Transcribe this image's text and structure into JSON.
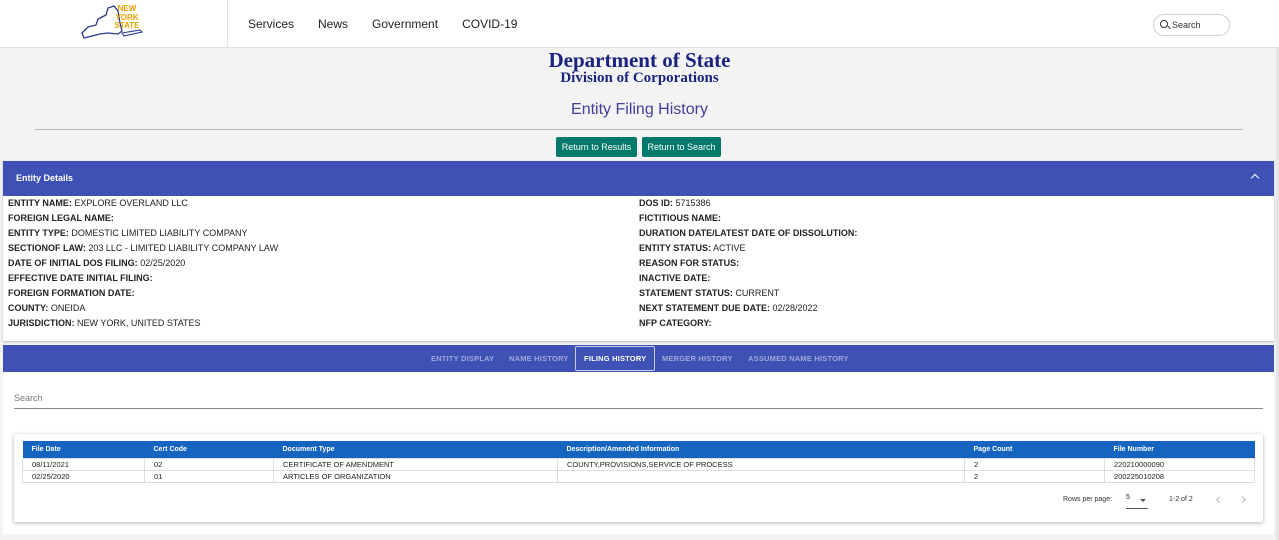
{
  "header": {
    "logo_lines": [
      "NEW",
      "YORK",
      "STATE"
    ],
    "nav": [
      "Services",
      "News",
      "Government",
      "COVID-19"
    ],
    "search_label": "Search"
  },
  "titles": {
    "department": "Department of State",
    "division": "Division of Corporations",
    "page": "Entity Filing History"
  },
  "buttons": {
    "return_results": "Return to Results",
    "return_search": "Return to Search"
  },
  "entity_details": {
    "heading": "Entity Details",
    "left": [
      {
        "label": "ENTITY NAME:",
        "value": "EXPLORE OVERLAND LLC"
      },
      {
        "label": "FOREIGN LEGAL NAME:",
        "value": ""
      },
      {
        "label": "ENTITY TYPE:",
        "value": "DOMESTIC LIMITED LIABILITY COMPANY"
      },
      {
        "label": "SECTIONOF LAW:",
        "value": "203 LLC - LIMITED LIABILITY COMPANY LAW"
      },
      {
        "label": "DATE OF INITIAL DOS FILING:",
        "value": "02/25/2020"
      },
      {
        "label": "EFFECTIVE DATE INITIAL FILING:",
        "value": ""
      },
      {
        "label": "FOREIGN FORMATION DATE:",
        "value": ""
      },
      {
        "label": "COUNTY:",
        "value": "ONEIDA"
      },
      {
        "label": "JURISDICTION:",
        "value": "NEW YORK, UNITED STATES"
      }
    ],
    "right": [
      {
        "label": "DOS ID:",
        "value": "5715386"
      },
      {
        "label": "FICTITIOUS NAME:",
        "value": ""
      },
      {
        "label": "DURATION DATE/LATEST DATE OF DISSOLUTION:",
        "value": ""
      },
      {
        "label": "ENTITY STATUS:",
        "value": "ACTIVE"
      },
      {
        "label": "REASON FOR STATUS:",
        "value": ""
      },
      {
        "label": "INACTIVE DATE:",
        "value": ""
      },
      {
        "label": "STATEMENT STATUS:",
        "value": "CURRENT"
      },
      {
        "label": "NEXT STATEMENT DUE DATE:",
        "value": "02/28/2022"
      },
      {
        "label": "NFP CATEGORY:",
        "value": ""
      }
    ]
  },
  "tabs": [
    "ENTITY DISPLAY",
    "NAME HISTORY",
    "FILING HISTORY",
    "MERGER HISTORY",
    "ASSUMED NAME HISTORY"
  ],
  "active_tab": "FILING HISTORY",
  "filter": {
    "placeholder": "Search"
  },
  "table": {
    "columns": [
      "File Date",
      "Cert Code",
      "Document Type",
      "Description/Amended Information",
      "Page Count",
      "File Number"
    ],
    "rows": [
      [
        "08/11/2021",
        "02",
        "CERTIFICATE OF AMENDMENT",
        "COUNTY,PROVISIONS,SERVICE OF PROCESS",
        "2",
        "220210000090"
      ],
      [
        "02/25/2020",
        "01",
        "ARTICLES OF ORGANIZATION",
        "",
        "2",
        "200225010208"
      ]
    ]
  },
  "pagination": {
    "rows_label": "Rows per page:",
    "rows_value": "5",
    "range": "1-2 of 2"
  },
  "colors": {
    "brand_navy": "#1a237e",
    "panel_blue": "#3f51b5",
    "table_header": "#1565c0",
    "button_teal": "#00796b",
    "logo_gold": "#e8a100"
  }
}
